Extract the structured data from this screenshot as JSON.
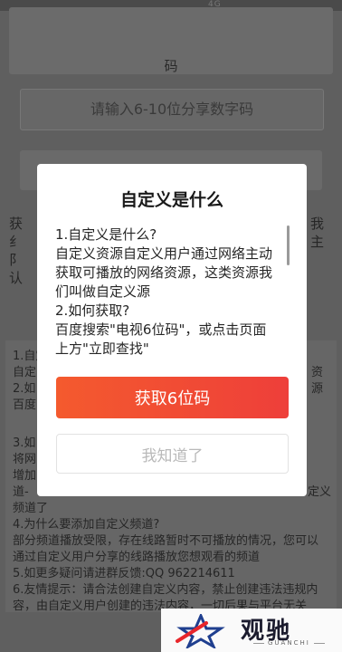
{
  "background": {
    "status_text": "4G",
    "code_label": "码",
    "code_placeholder": "请输入6-10位分享数字码",
    "side_left": [
      "获",
      "纟",
      "阝",
      "认"
    ],
    "side_right": [
      "我",
      "主"
    ],
    "lower_lines": [
      "1.自定",
      "自定",
      "2.如",
      "百度",
      "3.如",
      "将网",
      "增加",
      "道-",
      "频道了",
      "4.为什么要添加自定义频道?",
      "部分频道播放受限，存在线路暂时不可播放的情况，您可以",
      "通过自定义用户分享的线路播放您想观看的频道",
      "5.如更多疑问请进群反馈:QQ 962214611",
      "6.友情提示：请合法创建自定义内容，禁止创建违法违规内",
      "容，由自定义用户创建的违法内容，一切后果与平台无关"
    ],
    "lower_right_fragments": [
      "资",
      "源",
      "定义"
    ]
  },
  "dialog": {
    "title": "自定义是什么",
    "lines": [
      "1.自定义是什么?",
      "自定义资源自定义用户通过网络主动",
      "获取可播放的网络资源，这类资源我",
      "们叫做自定义源",
      "2.如何获取?",
      "百度搜索\"电视6位码\"，或点击页面",
      "上方\"立即查找\""
    ],
    "primary_button": "获取6位码",
    "secondary_button": "我知道了"
  },
  "watermark": {
    "brand": "观驰",
    "sub": "GUANCHI",
    "colors": {
      "star_red": "#e8262b",
      "star_blue": "#1f3f8f",
      "text": "#1b1b2e"
    }
  },
  "colors": {
    "primary_gradient_start": "#f45a2e",
    "primary_gradient_end": "#ee3f3a",
    "overlay": "#5f5f5f"
  }
}
